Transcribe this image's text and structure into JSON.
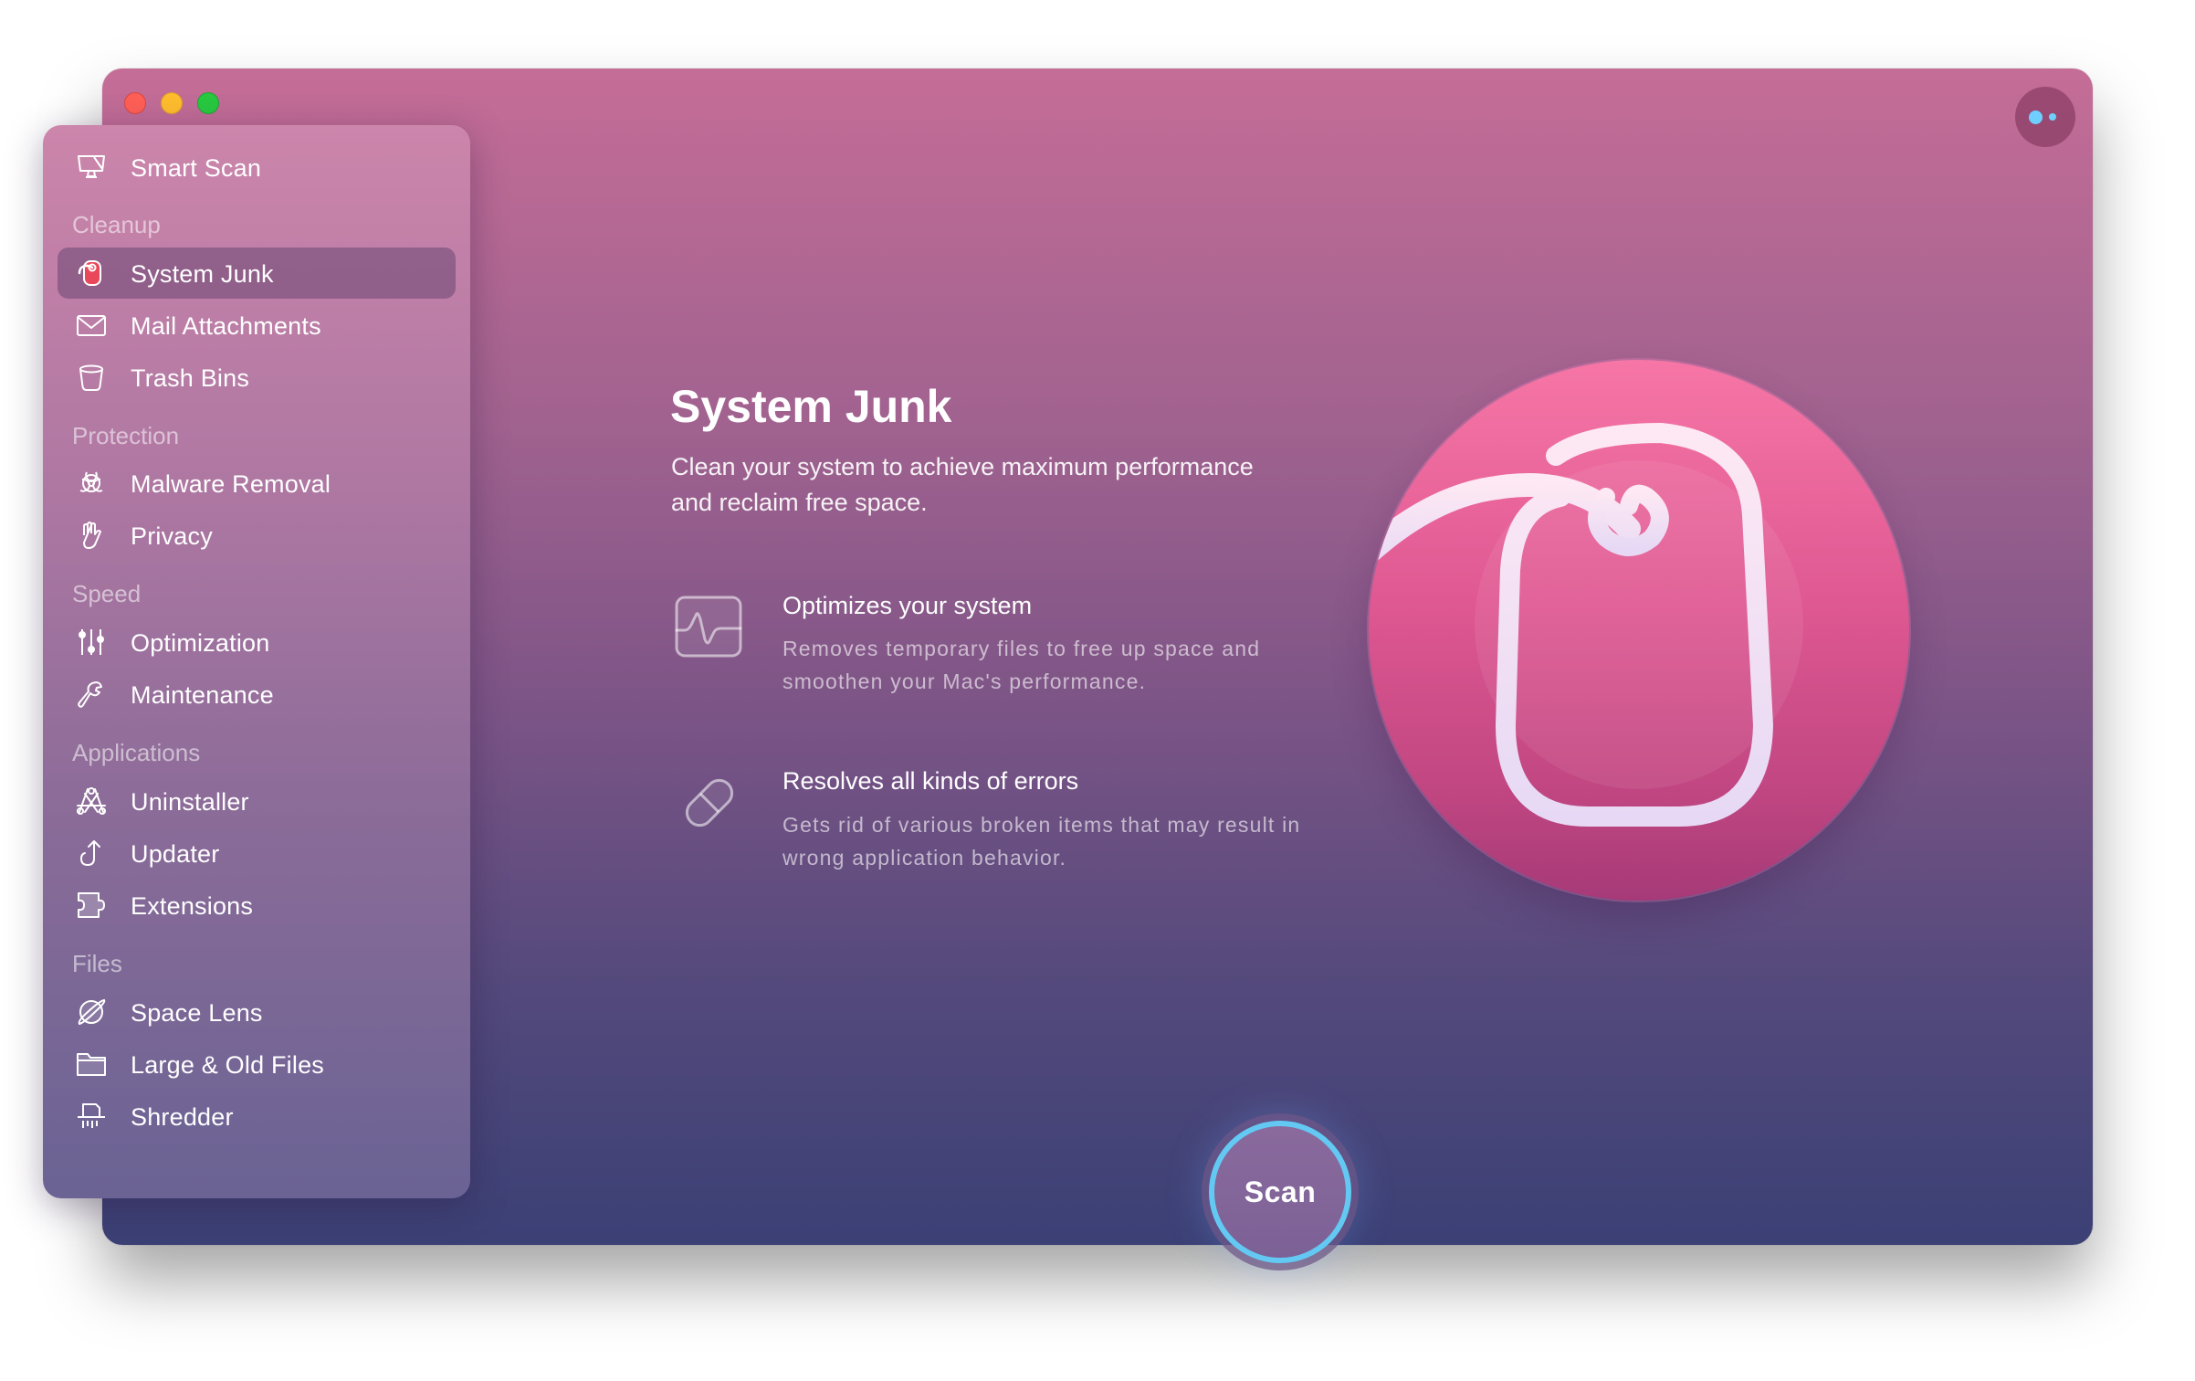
{
  "window": {
    "traffic_lights": [
      "close",
      "minimize",
      "zoom"
    ],
    "assistant_icon": "assistant-dots-icon"
  },
  "sidebar": {
    "top_item": {
      "label": "Smart Scan",
      "icon": "monitor-icon"
    },
    "sections": [
      {
        "title": "Cleanup",
        "items": [
          {
            "label": "System Junk",
            "icon": "system-junk-tag-icon",
            "selected": true
          },
          {
            "label": "Mail Attachments",
            "icon": "envelope-icon"
          },
          {
            "label": "Trash Bins",
            "icon": "trash-bin-icon"
          }
        ]
      },
      {
        "title": "Protection",
        "items": [
          {
            "label": "Malware Removal",
            "icon": "biohazard-icon"
          },
          {
            "label": "Privacy",
            "icon": "hand-icon"
          }
        ]
      },
      {
        "title": "Speed",
        "items": [
          {
            "label": "Optimization",
            "icon": "sliders-icon"
          },
          {
            "label": "Maintenance",
            "icon": "wrench-icon"
          }
        ]
      },
      {
        "title": "Applications",
        "items": [
          {
            "label": "Uninstaller",
            "icon": "app-store-icon"
          },
          {
            "label": "Updater",
            "icon": "update-arrow-icon"
          },
          {
            "label": "Extensions",
            "icon": "puzzle-icon"
          }
        ]
      },
      {
        "title": "Files",
        "items": [
          {
            "label": "Space Lens",
            "icon": "planet-icon"
          },
          {
            "label": "Large & Old Files",
            "icon": "folder-icon"
          },
          {
            "label": "Shredder",
            "icon": "shredder-icon"
          }
        ]
      }
    ]
  },
  "main": {
    "title": "System Junk",
    "description": "Clean your system to achieve maximum performance and reclaim free space.",
    "features": [
      {
        "title": "Optimizes your system",
        "description": "Removes temporary files to free up space and smoothen your Mac's performance.",
        "icon": "activity-monitor-icon"
      },
      {
        "title": "Resolves all kinds of errors",
        "description": "Gets rid of various broken items that may result in wrong application behavior.",
        "icon": "pill-icon"
      }
    ],
    "hero_icon": "system-junk-hero-icon",
    "scan_label": "Scan"
  },
  "colors": {
    "accent_ring": "#63c9f3",
    "window_top": "#c46d97",
    "window_bottom": "#3b4075",
    "hero_pink": "#df5892"
  }
}
